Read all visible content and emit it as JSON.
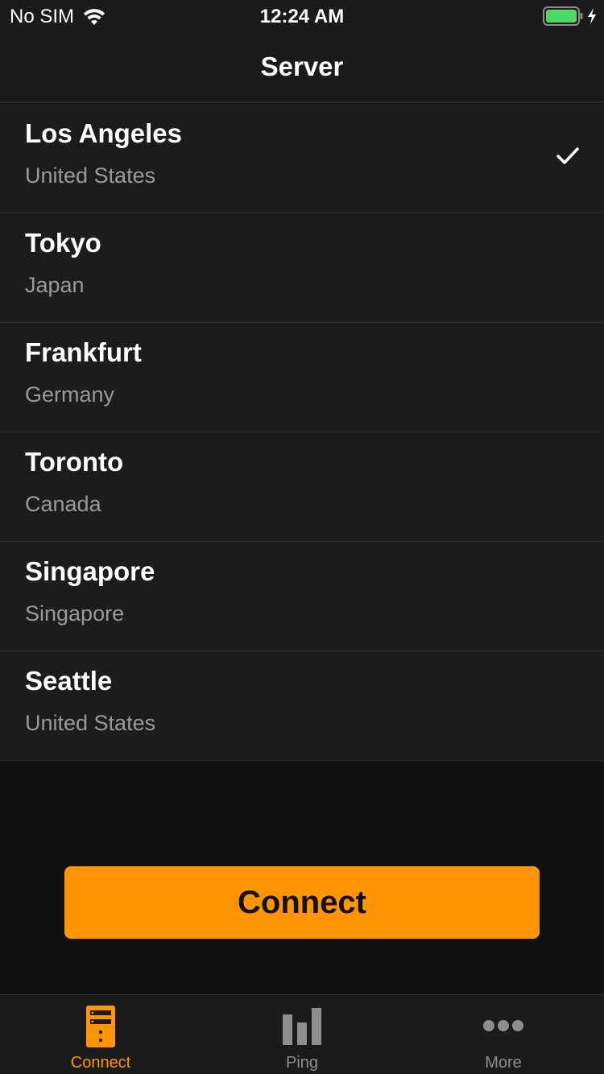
{
  "status_bar": {
    "carrier": "No SIM",
    "time": "12:24 AM",
    "battery_color": "#4cd964"
  },
  "nav": {
    "title": "Server"
  },
  "servers": [
    {
      "city": "Los Angeles",
      "country": "United States",
      "selected": true
    },
    {
      "city": "Tokyo",
      "country": "Japan",
      "selected": false
    },
    {
      "city": "Frankfurt",
      "country": "Germany",
      "selected": false
    },
    {
      "city": "Toronto",
      "country": "Canada",
      "selected": false
    },
    {
      "city": "Singapore",
      "country": "Singapore",
      "selected": false
    },
    {
      "city": "Seattle",
      "country": "United States",
      "selected": false
    }
  ],
  "connect_button": {
    "label": "Connect",
    "color": "#ff9500"
  },
  "tabs": [
    {
      "label": "Connect",
      "icon": "server-icon",
      "active": true
    },
    {
      "label": "Ping",
      "icon": "bar-chart-icon",
      "active": false
    },
    {
      "label": "More",
      "icon": "more-dots-icon",
      "active": false
    }
  ],
  "colors": {
    "accent": "#ff9500",
    "background": "#111111",
    "row_background": "#1c1c1c",
    "secondary_text": "#9a9a9a"
  }
}
